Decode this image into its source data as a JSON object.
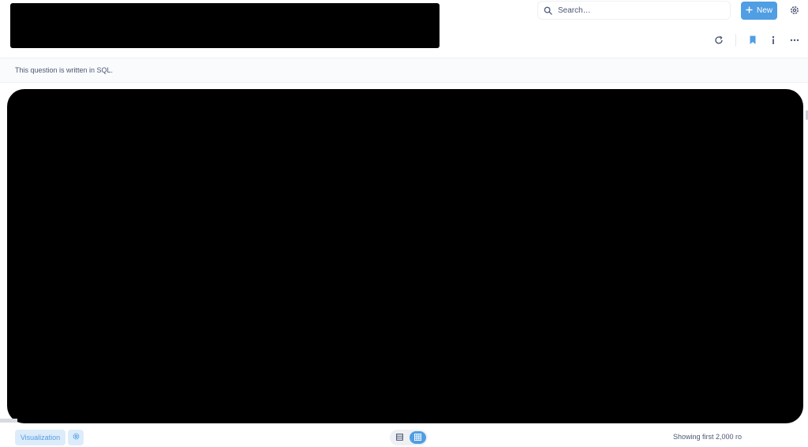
{
  "search": {
    "placeholder": "Search…"
  },
  "top_nav": {
    "new_label": "New"
  },
  "notice": {
    "text": "This question is written in SQL."
  },
  "footer": {
    "visualization_label": "Visualization",
    "row_status": "Showing first 2,000 ro"
  },
  "colors": {
    "accent": "#509ee3",
    "accent_light": "#ddecfa",
    "text": "#4c5773"
  },
  "icons": {
    "search": "search-icon",
    "plus": "plus-icon",
    "settings": "gear-icon",
    "refresh": "refresh-icon",
    "bookmark": "bookmark-icon",
    "info": "info-icon",
    "more": "ellipsis-icon",
    "table_view": "table-icon",
    "grid_view": "grid-icon"
  }
}
